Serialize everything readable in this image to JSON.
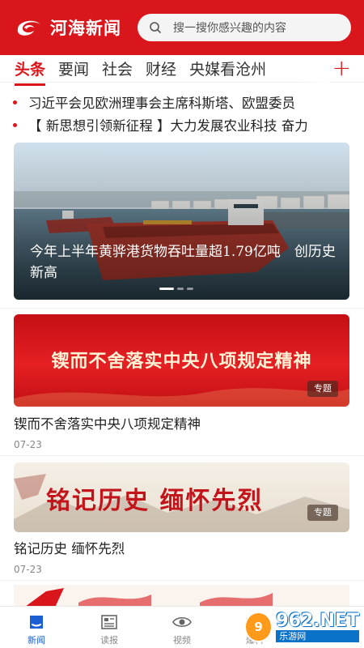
{
  "header": {
    "app_name": "河海新闻",
    "search_placeholder": "搜一搜你感兴趣的内容"
  },
  "tabs": [
    {
      "label": "头条",
      "active": true
    },
    {
      "label": "要闻",
      "active": false
    },
    {
      "label": "社会",
      "active": false
    },
    {
      "label": "财经",
      "active": false
    },
    {
      "label": "央媒看沧州",
      "active": false
    }
  ],
  "tab_add_label": "+",
  "headlines": [
    "习近平会见欧洲理事会主席科斯塔、欧盟委员",
    "【 新思想引领新征程 】大力发展农业科技 奋力"
  ],
  "carousel": {
    "caption": "今年上半年黄骅港货物吞吐量超1.79亿吨　创历史新高",
    "slide_count": 3,
    "active_slide": 1
  },
  "cards": [
    {
      "banner_text": "锲而不舍落实中央八项规定精神",
      "tag": "专题",
      "title": "锲而不舍落实中央八项规定精神",
      "date": "07-23"
    },
    {
      "banner_text": "铭记历史 缅怀先烈",
      "tag": "专题",
      "title": "铭记历史  缅怀先烈",
      "date": "07-23"
    }
  ],
  "bottom_nav": [
    {
      "label": "新闻",
      "icon": "news-home-icon",
      "active": true
    },
    {
      "label": "读报",
      "icon": "newspaper-icon",
      "active": false
    },
    {
      "label": "视频",
      "icon": "eye-video-icon",
      "active": false
    },
    {
      "label": "爆料",
      "icon": "camera-icon",
      "active": false
    }
  ],
  "watermark": {
    "badge": "9",
    "number": "962.NET",
    "site": "乐游网"
  },
  "colors": {
    "brand_red": "#d8161b",
    "active_blue": "#1c5fd4"
  }
}
